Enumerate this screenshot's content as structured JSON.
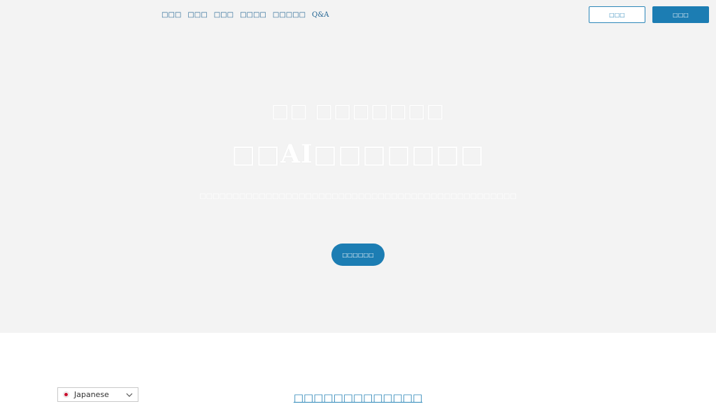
{
  "nav": {
    "items": [
      {
        "label": "□□□"
      },
      {
        "label": "□□□"
      },
      {
        "label": "□□□"
      },
      {
        "label": "□□□□"
      },
      {
        "label": "□□□□□"
      },
      {
        "label": "Q&A"
      }
    ]
  },
  "header": {
    "login_label": "□□□",
    "signup_label": "□□□"
  },
  "hero": {
    "title_line1": "□□ □□□□□□□",
    "title_line2": "□□AI□□□□□□□",
    "subtitle": "□□□□□□□□□□□□□□□□□□□□□□□□□□□□□□□□□□□□□□□□□□□□□□□□",
    "cta_label": "□□□□□□"
  },
  "section": {
    "heading": "□□□□□□□□□□□□□"
  },
  "language": {
    "selected": "Japanese",
    "flag": "japan-flag-icon"
  },
  "colors": {
    "accent": "#1c7db3",
    "nav_text": "#1b5f8f",
    "hero_bg": "#f3f3f3"
  }
}
